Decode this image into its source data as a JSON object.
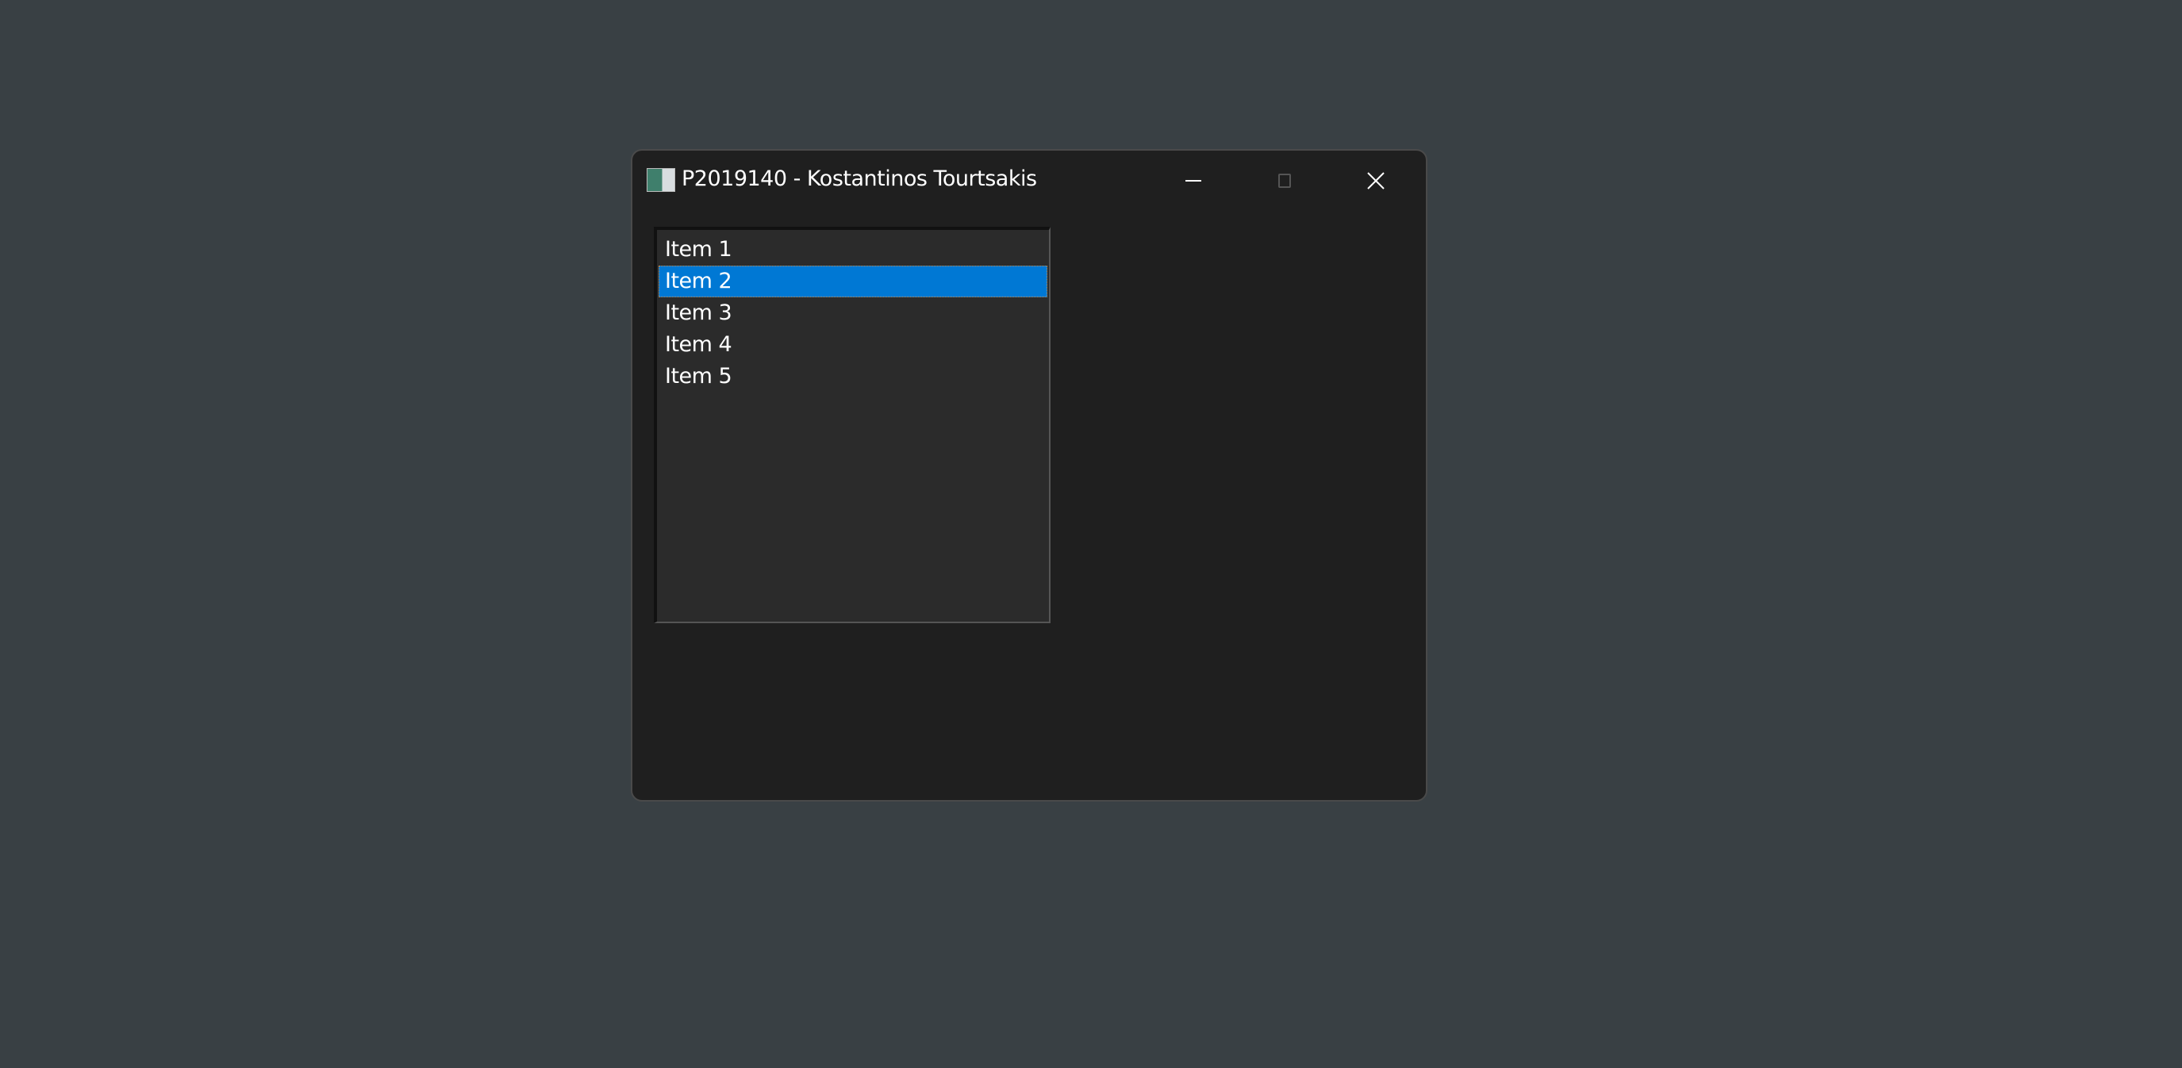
{
  "window": {
    "title": "P2019140 - Kostantinos Tourtsakis",
    "icon": "app-window-icon",
    "controls": {
      "minimize": "minimize-icon",
      "maximize": "maximize-icon",
      "close": "close-icon"
    }
  },
  "listbox": {
    "items": [
      "Item 1",
      "Item 2",
      "Item 3",
      "Item 4",
      "Item 5"
    ],
    "selected": "Item 2"
  },
  "colors": {
    "desktop": "#394044",
    "window": "#1f1f1f",
    "listbox": "#2b2b2b",
    "selection": "#0078d4"
  }
}
